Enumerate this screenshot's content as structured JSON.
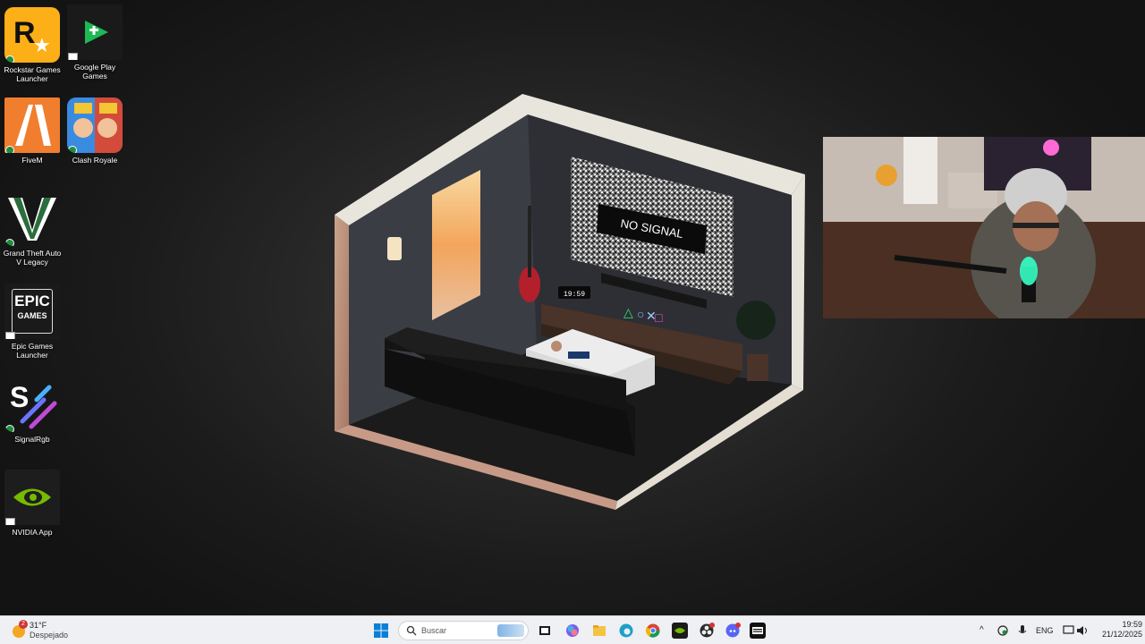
{
  "desktop": {
    "icons": [
      {
        "label": "Rockstar Games Launcher",
        "icon": "rockstar-icon",
        "badge": "synced"
      },
      {
        "label": "Google Play Games",
        "icon": "google-play-games-icon",
        "badge": "shortcut"
      },
      {
        "label": "FiveM",
        "icon": "fivem-icon",
        "badge": "synced"
      },
      {
        "label": "Clash Royale",
        "icon": "clash-royale-icon",
        "badge": "synced"
      },
      {
        "label": "Grand Theft Auto V Legacy",
        "icon": "gta-v-icon",
        "badge": "synced"
      },
      {
        "label": "Epic Games Launcher",
        "icon": "epic-games-icon",
        "badge": "shortcut",
        "logo_line1": "EPIC",
        "logo_line2": "GAMES"
      },
      {
        "label": "SignalRgb",
        "icon": "signalrgb-icon",
        "badge": "synced"
      },
      {
        "label": "NVIDIA App",
        "icon": "nvidia-icon",
        "badge": "shortcut"
      }
    ]
  },
  "wallpaper": {
    "tv_text": "NO SIGNAL",
    "clock_text": "19:59"
  },
  "webcam": {
    "description_icon": "webcam-feed"
  },
  "taskbar": {
    "weather": {
      "temp": "31°F",
      "condition": "Despejado",
      "badge": "2"
    },
    "search_placeholder": "Buscar",
    "apps": [
      "start-icon",
      "search-icon",
      "task-view-icon",
      "copilot-icon",
      "file-explorer-icon",
      "edge-icon",
      "chrome-icon",
      "nvidia-taskbar-icon",
      "obs-icon",
      "discord-icon",
      "call-of-duty-icon"
    ],
    "tray": {
      "language": "ENG",
      "time": "19:59",
      "date": "21/12/2025"
    }
  },
  "colors": {
    "accent": "#0067c0",
    "nvidia": "#76b900",
    "rockstar": "#fcaf17",
    "fivem": "#f07e2e",
    "discord": "#5865f2"
  }
}
